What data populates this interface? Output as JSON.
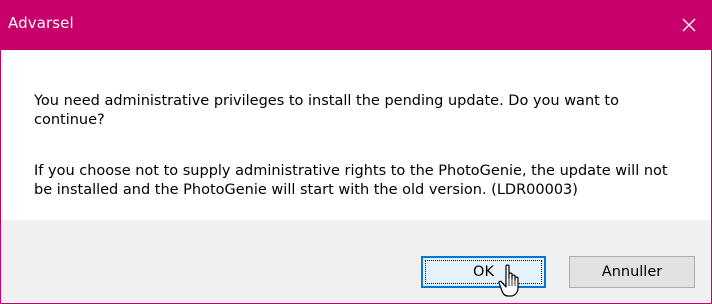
{
  "window": {
    "title": "Advarsel",
    "accent_color": "#c8006b",
    "close_icon": "close-icon"
  },
  "message": {
    "line1": "You need administrative privileges to install the pending update. Do you want to continue?",
    "line2": "If you choose not to supply administrative rights to the PhotoGenie, the update will not be installed and the PhotoGenie will start with the old version. (LDR00003)"
  },
  "buttons": {
    "ok_label": "OK",
    "cancel_label": "Annuller"
  },
  "cursor": {
    "icon": "hand-pointer-icon"
  }
}
